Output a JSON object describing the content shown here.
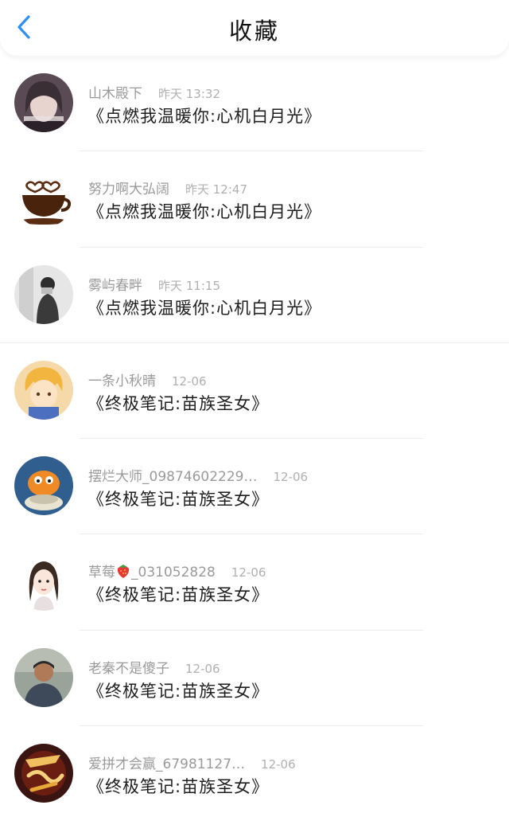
{
  "header": {
    "title": "收藏",
    "back_icon": "chevron-left-icon",
    "accent": "#2f8ff5"
  },
  "items": [
    {
      "name": "山木殿下",
      "time": "昨天 13:32",
      "title": "《点燃我温暖你:心机白月光》",
      "avatar": "avatar-girl-photo"
    },
    {
      "name": "努力啊大弘阔",
      "time": "昨天 12:47",
      "title": "《点燃我温暖你:心机白月光》",
      "avatar": "avatar-coffee-cup"
    },
    {
      "name": "雾屿春畔",
      "time": "昨天 11:15",
      "title": "《点燃我温暖你:心机白月光》",
      "avatar": "avatar-mirror-selfie"
    },
    {
      "name": "一条小秋晴",
      "time": "12-06",
      "title": "《终极笔记:苗族圣女》",
      "avatar": "avatar-anime-boy"
    },
    {
      "name": "摆烂大师_09874602229…",
      "time": "12-06",
      "title": "《终极笔记:苗族圣女》",
      "avatar": "avatar-garfield"
    },
    {
      "name": "草莓",
      "name_suffix": "_031052828",
      "time": "12-06",
      "title": "《终极笔记:苗族圣女》",
      "avatar": "avatar-illustrated-girl"
    },
    {
      "name": "老秦不是傻子",
      "time": "12-06",
      "title": "《终极笔记:苗族圣女》",
      "avatar": "avatar-man-photo"
    },
    {
      "name": "爱拼才会赢_67981127…",
      "time": "12-06",
      "title": "《终极笔记:苗族圣女》",
      "avatar": "avatar-calligraphy-art"
    }
  ]
}
